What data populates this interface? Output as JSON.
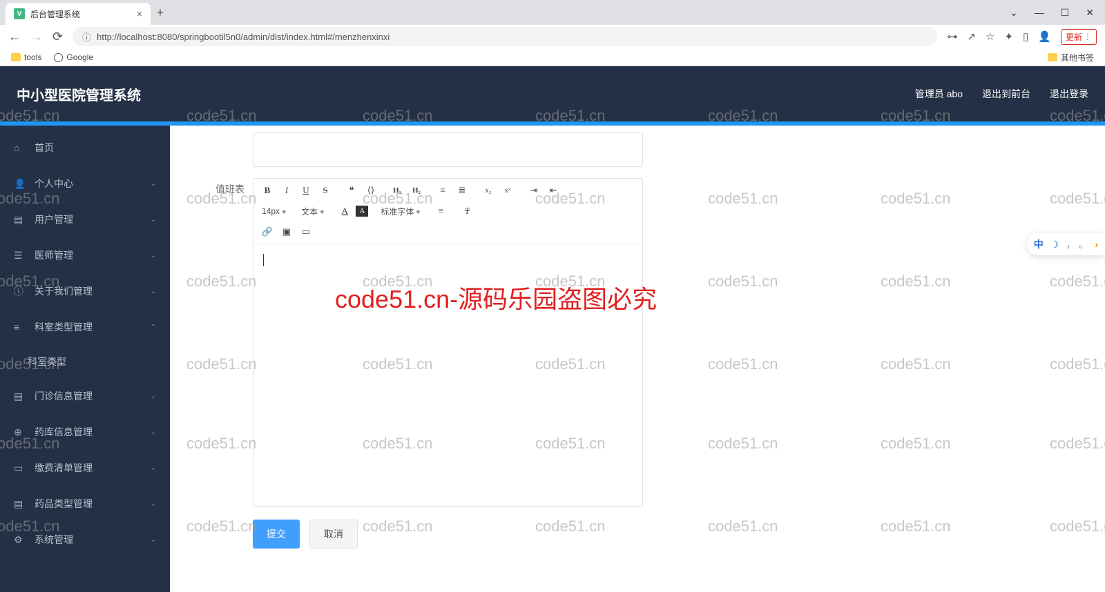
{
  "browser": {
    "tab_title": "后台管理系统",
    "tab_icon": "V",
    "url": "http://localhost:8080/springbootil5n0/admin/dist/index.html#/menzhenxinxi",
    "update_label": "更新",
    "bookmarks": {
      "tools": "tools",
      "google": "Google",
      "other": "其他书签"
    }
  },
  "header": {
    "title": "中小型医院管理系统",
    "user": "管理员 abo",
    "logout_front": "退出到前台",
    "logout": "退出登录"
  },
  "sidebar": {
    "home": "首页",
    "personal": "个人中心",
    "users": "用户管理",
    "doctors": "医师管理",
    "about": "关于我们管理",
    "dept_type": "科室类型管理",
    "dept_type_sub": "科室类型",
    "outpatient": "门诊信息管理",
    "pharmacy": "药库信息管理",
    "billing": "缴费清单管理",
    "drug_type": "药品类型管理",
    "system": "系统管理"
  },
  "form": {
    "label": "值班表",
    "font_size": "14px",
    "text_style": "文本",
    "font_family": "标准字体",
    "submit": "提交",
    "cancel": "取消"
  },
  "watermark": {
    "text": "code51.cn",
    "red": "code51.cn-源码乐园盗图必究"
  },
  "float": {
    "zh": "中",
    "comma": "，",
    "period": "。"
  }
}
